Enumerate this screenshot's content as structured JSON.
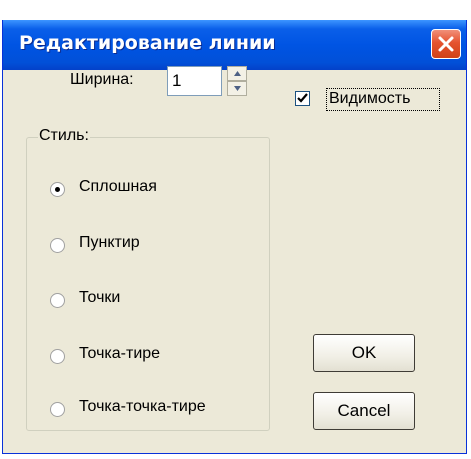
{
  "window": {
    "title": "Редактирование линии"
  },
  "width_field": {
    "label": "Ширина:",
    "value": "1"
  },
  "visibility": {
    "label": "Видимость",
    "checked": true
  },
  "style_group": {
    "label": "Стиль:",
    "options": [
      "Сплошная",
      "Пунктир",
      "Точки",
      "Точка-тире",
      "Точка-точка-тире"
    ],
    "selected": 0
  },
  "buttons": {
    "ok": "OK",
    "cancel": "Cancel"
  },
  "colors": {
    "title_bar": "#0054e3",
    "window_bg": "#ece9d8",
    "close_button": "#e5532f"
  },
  "icons": [
    "close-icon",
    "spin-up-icon",
    "spin-down-icon",
    "checkmark-icon"
  ]
}
